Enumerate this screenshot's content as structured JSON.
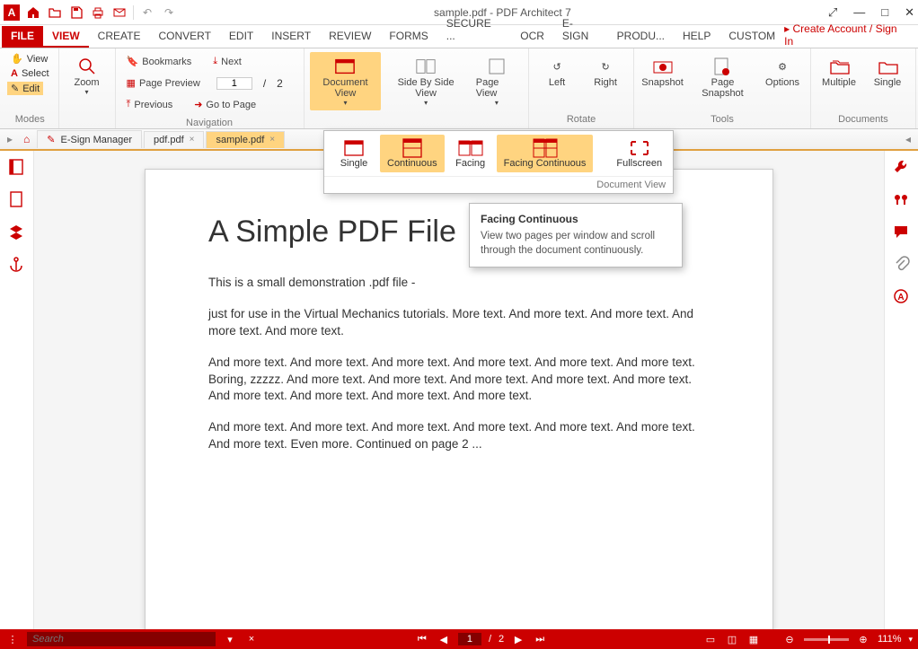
{
  "app": {
    "title": "sample.pdf   -   PDF Architect 7"
  },
  "account_link": "▸  Create Account / Sign In",
  "tabs": [
    "FILE",
    "VIEW",
    "CREATE",
    "CONVERT",
    "EDIT",
    "INSERT",
    "REVIEW",
    "FORMS",
    "SECURE ...",
    "OCR",
    "E-SIGN",
    "PRODU...",
    "HELP",
    "CUSTOM"
  ],
  "ribbon": {
    "modes": {
      "view": "View",
      "select": "Select",
      "edit": "Edit",
      "group": "Modes"
    },
    "zoom": {
      "label": "Zoom"
    },
    "nav": {
      "bookmarks": "Bookmarks",
      "preview": "Page Preview",
      "previous": "Previous",
      "next": "Next",
      "goto": "Go to Page",
      "page_current": "1",
      "page_sep": "/",
      "page_total": "2",
      "group": "Navigation"
    },
    "docview_btn": "Document View",
    "sidebyside": "Side By Side View",
    "pageview": "Page View",
    "rotate": {
      "left": "Left",
      "right": "Right",
      "group": "Rotate"
    },
    "tools": {
      "snapshot": "Snapshot",
      "pagesnapshot": "Page Snapshot",
      "options": "Options",
      "group": "Tools"
    },
    "documents": {
      "multiple": "Multiple",
      "single": "Single",
      "group": "Documents"
    }
  },
  "doctabs": [
    {
      "label": "E-Sign Manager",
      "icon": "esign"
    },
    {
      "label": "pdf.pdf",
      "close": "×"
    },
    {
      "label": "sample.pdf",
      "close": "×",
      "active": true
    }
  ],
  "dropdown": {
    "single": "Single",
    "continuous": "Continuous",
    "facing": "Facing",
    "facing_continuous": "Facing Continuous",
    "fullscreen": "Fullscreen",
    "group": "Document View"
  },
  "tooltip": {
    "title": "Facing Continuous",
    "body": "View two pages per window and scroll through the document continuously."
  },
  "document": {
    "heading": "A Simple PDF File",
    "p1": "This is a small demonstration .pdf file -",
    "p2": "just for use in the Virtual Mechanics tutorials. More text. And more text. And more text. And more text. And more text.",
    "p3": "And more text. And more text. And more text. And more text. And more text. And more text. Boring, zzzzz. And more text. And more text. And more text. And more text. And more text. And more text. And more text. And more text. And more text.",
    "p4": "And more text. And more text. And more text. And more text. And more text. And more text. And more text. Even more. Continued on page 2 ..."
  },
  "status": {
    "search_placeholder": "Search",
    "page_current": "1",
    "page_sep": "/",
    "page_total": "2",
    "zoom": "111%"
  }
}
